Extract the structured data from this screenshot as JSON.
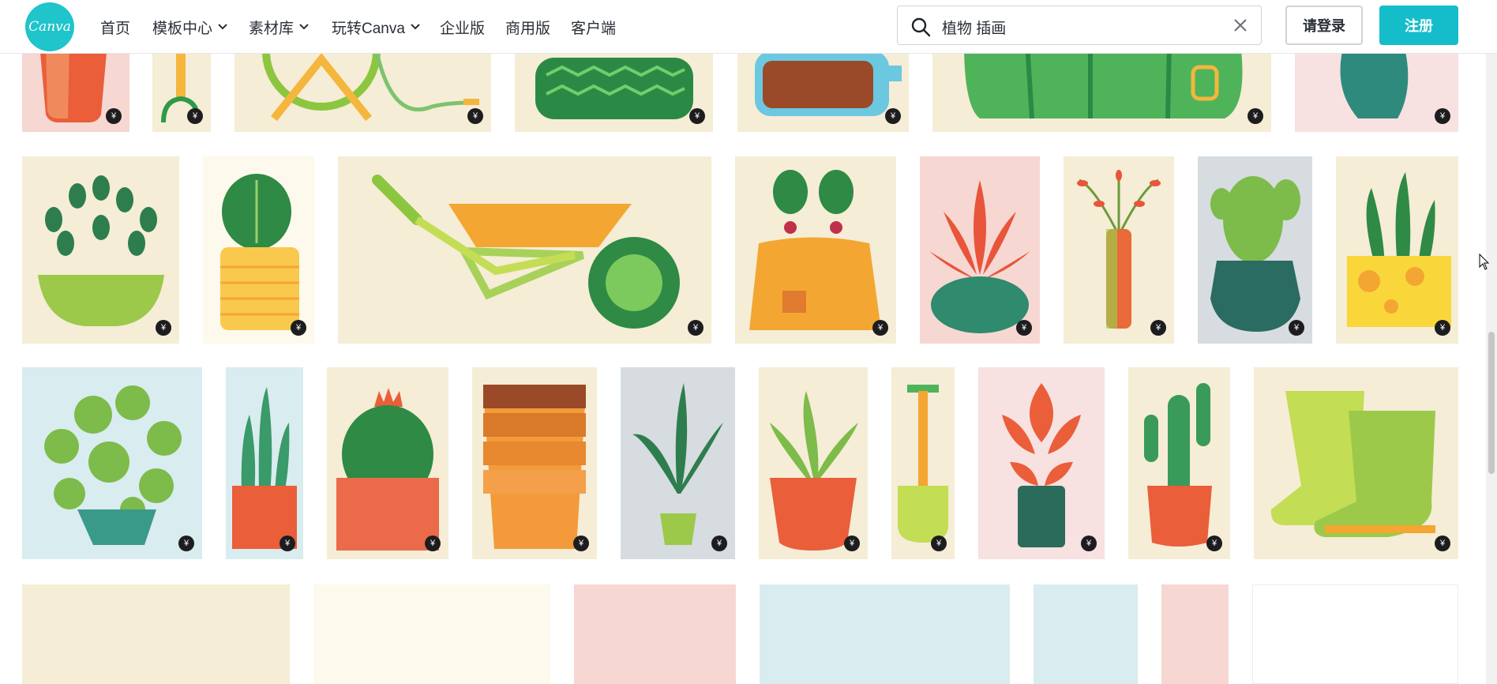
{
  "header": {
    "logo_text": "Canva",
    "nav": [
      {
        "label": "首页",
        "dropdown": false
      },
      {
        "label": "模板中心",
        "dropdown": true
      },
      {
        "label": "素材库",
        "dropdown": true
      },
      {
        "label": "玩转Canva",
        "dropdown": true
      },
      {
        "label": "企业版",
        "dropdown": false
      },
      {
        "label": "商用版",
        "dropdown": false
      },
      {
        "label": "客户端",
        "dropdown": false
      }
    ],
    "search": {
      "value": "植物 插画",
      "icon": "search-icon",
      "clear_icon": "close-icon"
    },
    "login_label": "请登录",
    "signup_label": "注册"
  },
  "badge_symbol": "¥",
  "colors": {
    "brand": "#20c4cb",
    "signup": "#15bdcb"
  },
  "tiles": [
    {
      "name": "red-pot",
      "bg": "#f6d7d2",
      "icon": "red-pot-illustration",
      "paid": true
    },
    {
      "name": "garden-tool",
      "bg": "#f5edd6",
      "icon": "garden-tool-illustration",
      "paid": true
    },
    {
      "name": "hose-reel",
      "bg": "#f5edd6",
      "icon": "hose-reel-illustration",
      "paid": true
    },
    {
      "name": "zigzag-planter",
      "bg": "#f5edd6",
      "icon": "planter-illustration",
      "paid": true
    },
    {
      "name": "bottle",
      "bg": "#f5edd6",
      "icon": "bottle-illustration",
      "paid": true
    },
    {
      "name": "watering-can",
      "bg": "#f5edd6",
      "icon": "watering-can-illustration",
      "paid": true
    },
    {
      "name": "teal-vase",
      "bg": "#f8e1e1",
      "icon": "vase-illustration",
      "paid": true
    },
    {
      "name": "bowl-plant",
      "bg": "#f5edd6",
      "icon": "bowl-plant-illustration",
      "paid": true
    },
    {
      "name": "fiddle-leaf",
      "bg": "#fdf9ec",
      "icon": "fiddle-leaf-illustration",
      "paid": true
    },
    {
      "name": "wheelbarrow",
      "bg": "#f5edd6",
      "icon": "wheelbarrow-illustration",
      "paid": true
    },
    {
      "name": "radish-sack",
      "bg": "#f5edd6",
      "icon": "radish-sack-illustration",
      "paid": true
    },
    {
      "name": "red-leaf-pot",
      "bg": "#f6d7d2",
      "icon": "red-leaf-plant-illustration",
      "paid": true
    },
    {
      "name": "tall-vase",
      "bg": "#f5edd6",
      "icon": "tall-vase-illustration",
      "paid": true
    },
    {
      "name": "cactus-teal-pot",
      "bg": "#d6dcdf",
      "icon": "cactus-illustration",
      "paid": true
    },
    {
      "name": "snake-plant-yellow",
      "bg": "#f5edd6",
      "icon": "snake-plant-illustration",
      "paid": true
    },
    {
      "name": "pilea",
      "bg": "#d9ecef",
      "icon": "pilea-illustration",
      "paid": true
    },
    {
      "name": "snake-plant-red",
      "bg": "#d9ecef",
      "icon": "snake-plant-illustration",
      "paid": true
    },
    {
      "name": "barrel-cactus",
      "bg": "#f5edd6",
      "icon": "barrel-cactus-illustration",
      "paid": true
    },
    {
      "name": "stacked-pots",
      "bg": "#f5edd6",
      "icon": "stacked-pots-illustration",
      "paid": true
    },
    {
      "name": "bird-of-paradise",
      "bg": "#d6dcdf",
      "icon": "palm-plant-illustration",
      "paid": true
    },
    {
      "name": "aloe-red-pot",
      "bg": "#f5edd6",
      "icon": "aloe-illustration",
      "paid": true
    },
    {
      "name": "shovel",
      "bg": "#f5edd6",
      "icon": "shovel-illustration",
      "paid": true
    },
    {
      "name": "anthurium",
      "bg": "#f8e1e1",
      "icon": "anthurium-illustration",
      "paid": true
    },
    {
      "name": "saguaro",
      "bg": "#f5edd6",
      "icon": "saguaro-illustration",
      "paid": true
    },
    {
      "name": "rain-boots",
      "bg": "#f5edd6",
      "icon": "boots-illustration",
      "paid": true
    },
    {
      "name": "row4-a",
      "bg": "#f5edd6",
      "icon": "",
      "paid": false
    },
    {
      "name": "row4-b",
      "bg": "#fdf9ec",
      "icon": "",
      "paid": false
    },
    {
      "name": "row4-c",
      "bg": "#f6d7d2",
      "icon": "",
      "paid": false
    },
    {
      "name": "row4-d",
      "bg": "#d9ecef",
      "icon": "",
      "paid": false
    },
    {
      "name": "row4-e",
      "bg": "#d9ecef",
      "icon": "",
      "paid": false
    },
    {
      "name": "row4-f",
      "bg": "#f6d7d2",
      "icon": "",
      "paid": false
    },
    {
      "name": "row4-g",
      "bg": "#ffffff",
      "icon": "",
      "paid": false
    }
  ],
  "scrollbar": {
    "position_fraction": 0.57
  }
}
